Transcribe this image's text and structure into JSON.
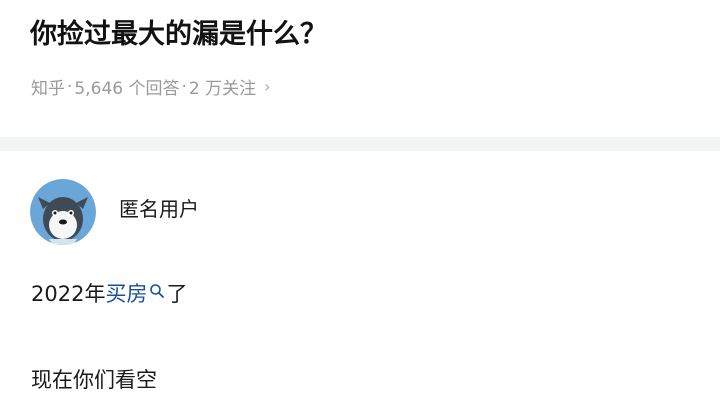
{
  "question": {
    "title": "你捡过最大的漏是什么？",
    "meta": {
      "site": "知乎",
      "separator": "·",
      "answers": "5,646 个回答",
      "followers": "2 万关注",
      "chevron_icon": "chevron-right-icon"
    }
  },
  "answer": {
    "author": {
      "name": "匿名用户",
      "avatar_icon": "anonymous-seal-avatar"
    },
    "paragraphs": {
      "p1": {
        "before": "2022年",
        "link_text": "买房",
        "search_icon": "search-icon",
        "after": "了"
      },
      "p2": "现在你们看空"
    }
  },
  "colors": {
    "link": "#175199",
    "meta": "#9a9a9a",
    "background": "#f3f4f6",
    "card": "#ffffff",
    "avatar_blue": "#6aa6d8"
  }
}
